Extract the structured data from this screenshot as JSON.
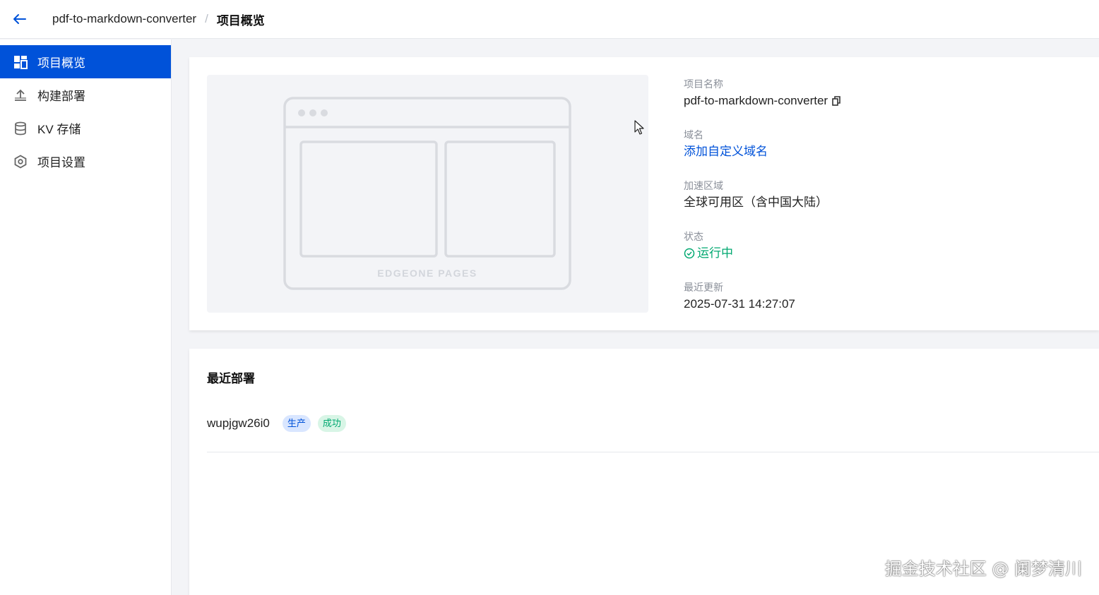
{
  "topbar": {
    "project_name": "pdf-to-markdown-converter",
    "separator": "/",
    "current_page": "项目概览"
  },
  "sidebar": {
    "items": [
      {
        "label": "项目概览",
        "icon": "dashboard-icon",
        "active": true
      },
      {
        "label": "构建部署",
        "icon": "upload-icon",
        "active": false
      },
      {
        "label": "KV 存储",
        "icon": "database-icon",
        "active": false
      },
      {
        "label": "项目设置",
        "icon": "settings-icon",
        "active": false
      }
    ]
  },
  "overview": {
    "preview_caption": "EDGEONE PAGES",
    "project_name_label": "项目名称",
    "project_name_value": "pdf-to-markdown-converter",
    "domain_label": "域名",
    "domain_value": "添加自定义域名",
    "region_label": "加速区域",
    "region_value": "全球可用区（含中国大陆）",
    "status_label": "状态",
    "status_value": "运行中",
    "updated_label": "最近更新",
    "updated_value": "2025-07-31 14:27:07"
  },
  "deployments": {
    "title": "最近部署",
    "items": [
      {
        "id": "wupjgw26i0",
        "env_tag": "生产",
        "status_tag": "成功"
      }
    ]
  },
  "watermark": "掘金技术社区 @ 阑梦清川",
  "colors": {
    "brand": "#0052d9",
    "success": "#00a870",
    "background": "#f3f4f7"
  }
}
